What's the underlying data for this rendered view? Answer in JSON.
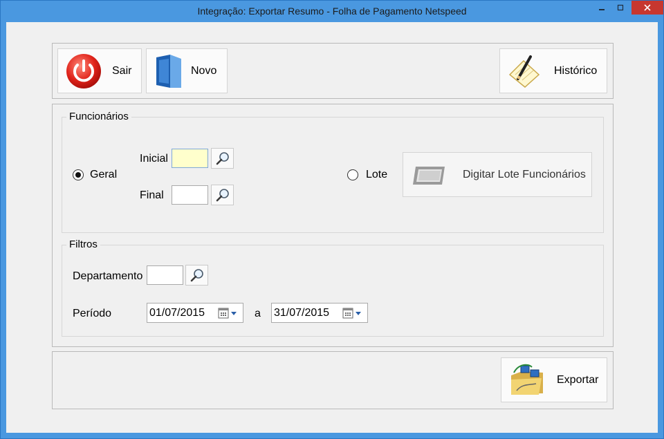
{
  "window": {
    "title": "Integração: Exportar Resumo - Folha de Pagamento Netspeed"
  },
  "toolbar": {
    "sair": "Sair",
    "novo": "Novo",
    "historico": "Histórico"
  },
  "funcionarios": {
    "title": "Funcionários",
    "geral": "Geral",
    "inicial": "Inicial",
    "final": "Final",
    "lote": "Lote",
    "digitar_lote": "Digitar Lote Funcionários"
  },
  "filtros": {
    "title": "Filtros",
    "departamento": "Departamento",
    "periodo": "Período",
    "data_inicial": "01/07/2015",
    "separador": "a",
    "data_final": "31/07/2015"
  },
  "footer": {
    "exportar": "Exportar"
  },
  "colors": {
    "title_bar": "#4a98e0",
    "close": "#c7372f",
    "highlight_field": "#ffffcc"
  },
  "icons": [
    "power-icon",
    "folder-icon",
    "notepad-pencil-icon",
    "search-icon",
    "batch-icon",
    "calendar-icon",
    "export-icon"
  ]
}
